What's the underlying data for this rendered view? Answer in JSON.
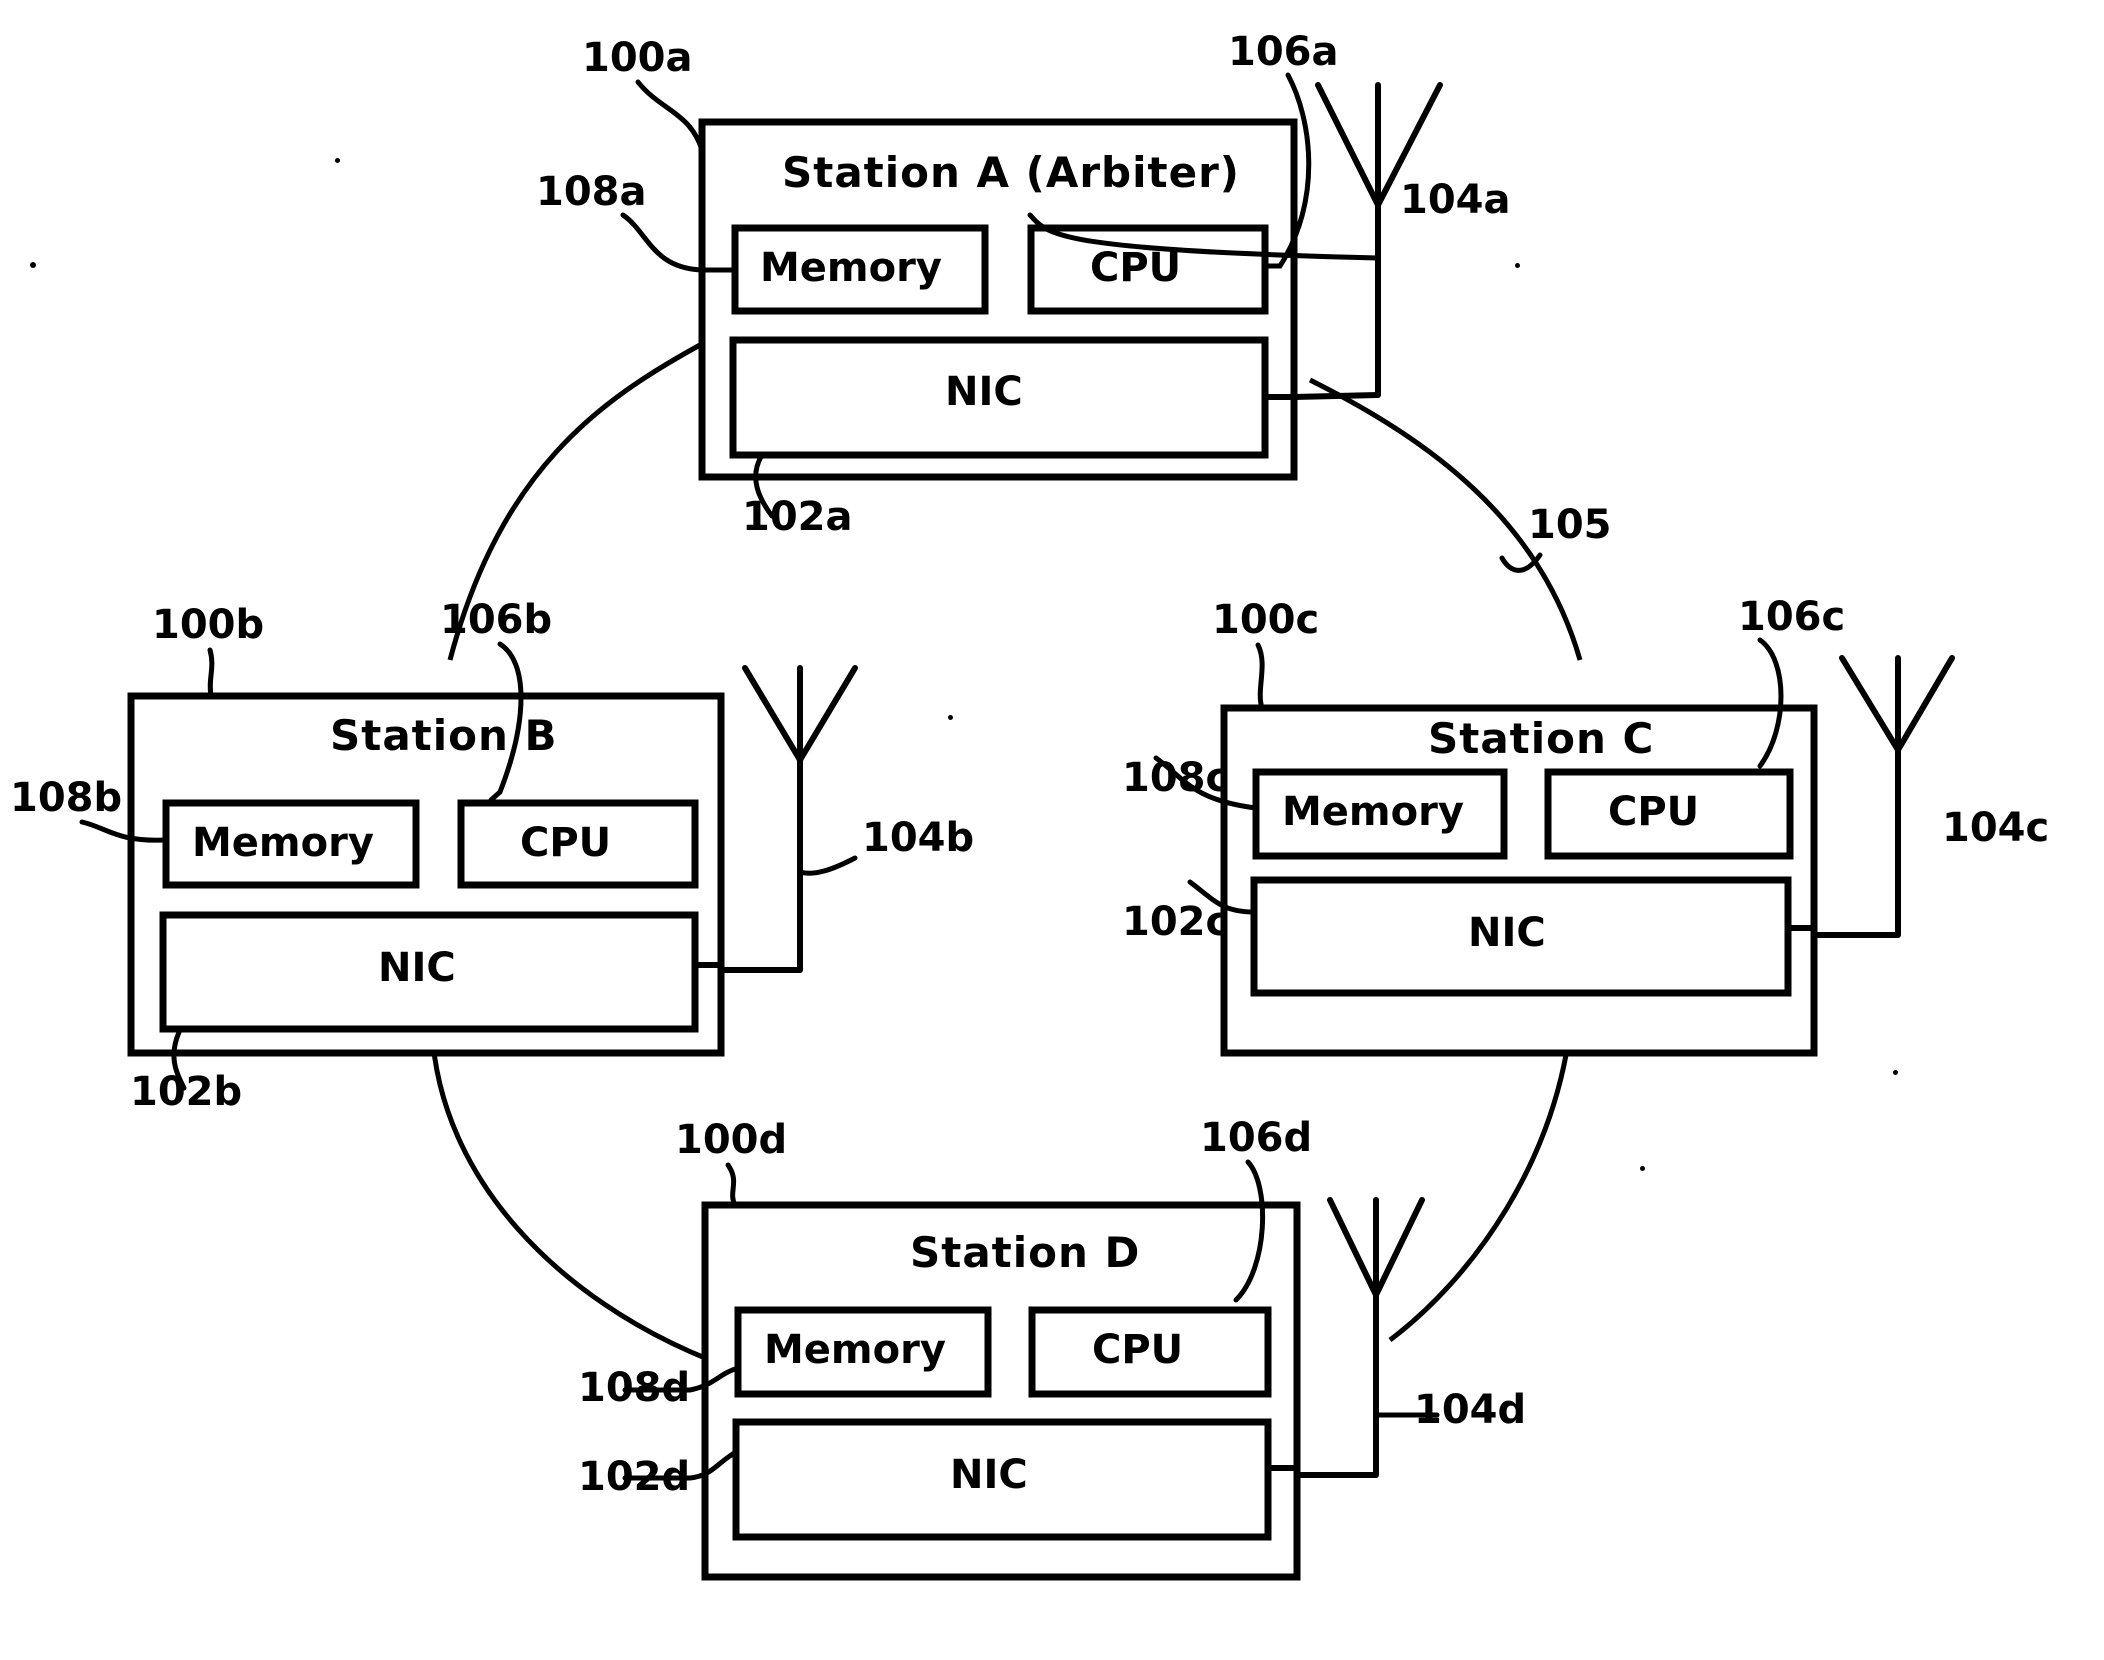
{
  "figure": {
    "type": "patent-block-diagram",
    "background_color": "#ffffff",
    "line_color": "#000000"
  },
  "stations": [
    {
      "id": "a",
      "title": "Station A  (Arbiter)",
      "station_ref": "100a",
      "nic_label": "NIC",
      "nic_ref": "102a",
      "memory_label": "Memory",
      "memory_ref": "108a",
      "cpu_label": "CPU",
      "cpu_ref": "106a",
      "antenna_ref": "104a"
    },
    {
      "id": "b",
      "title": "Station B",
      "station_ref": "100b",
      "nic_label": "NIC",
      "nic_ref": "102b",
      "memory_label": "Memory",
      "memory_ref": "108b",
      "cpu_label": "CPU",
      "cpu_ref": "106b",
      "antenna_ref": "104b"
    },
    {
      "id": "c",
      "title": "Station C",
      "station_ref": "100c",
      "nic_label": "NIC",
      "nic_ref": "102c",
      "memory_label": "Memory",
      "memory_ref": "108c",
      "cpu_label": "CPU",
      "cpu_ref": "106c",
      "antenna_ref": "104c"
    },
    {
      "id": "d",
      "title": "Station D",
      "station_ref": "100d",
      "nic_label": "NIC",
      "nic_ref": "102d",
      "memory_label": "Memory",
      "memory_ref": "108d",
      "cpu_label": "CPU",
      "cpu_ref": "106d",
      "antenna_ref": "104d"
    }
  ],
  "network": {
    "ref": "105"
  }
}
